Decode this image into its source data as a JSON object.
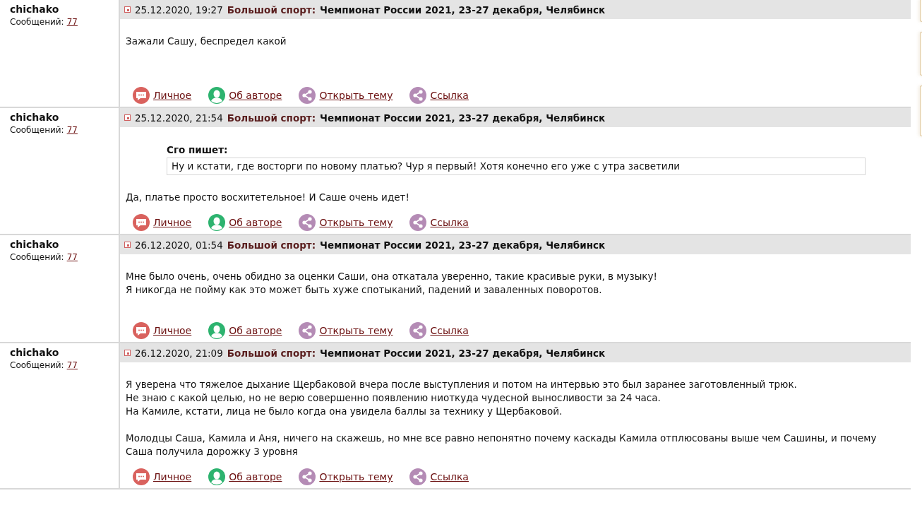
{
  "posts": [
    {
      "author": "chichako",
      "count_label": "Сообщений:",
      "count": "77",
      "date": "25.12.2020, 19:27",
      "forum": "Большой спорт:",
      "topic": "Чемпионат России 2021, 23-27 декабря, Челябинск",
      "paragraphs": [
        [
          "Зажали Сашу, беспредел какой"
        ]
      ],
      "actions": [
        {
          "kind": "message",
          "label": "Личное"
        },
        {
          "kind": "profile",
          "label": "Об авторе"
        },
        {
          "kind": "share",
          "label": "Открыть тему"
        },
        {
          "kind": "share",
          "label": "Ссылка"
        }
      ]
    },
    {
      "author": "chichako",
      "count_label": "Сообщений:",
      "count": "77",
      "date": "25.12.2020, 21:54",
      "forum": "Большой спорт:",
      "topic": "Чемпионат России 2021, 23-27 декабря, Челябинск",
      "quote": {
        "author": "Сго пишет:",
        "text": "Ну и кстати, где восторги по новому платью? Чур я первый! Хотя конечно его уже с утра засветили"
      },
      "paragraphs": [
        [
          "Да, платье просто восхитетельное! И Саше очень идет!"
        ]
      ],
      "actions": [
        {
          "kind": "message",
          "label": "Личное"
        },
        {
          "kind": "profile",
          "label": "Об авторе"
        },
        {
          "kind": "share",
          "label": "Открыть тему"
        },
        {
          "kind": "share",
          "label": "Ссылка"
        }
      ]
    },
    {
      "author": "chichako",
      "count_label": "Сообщений:",
      "count": "77",
      "date": "26.12.2020, 01:54",
      "forum": "Большой спорт:",
      "topic": "Чемпионат России 2021, 23-27 декабря, Челябинск",
      "paragraphs": [
        [
          "Мне было очень, очень обидно за оценки Саши, она откатала уверенно, такие красивые руки, в музыку!",
          "Я никогда не пойму как это может быть хуже спотыканий, падений и заваленных поворотов."
        ]
      ],
      "actions": [
        {
          "kind": "message",
          "label": "Личное"
        },
        {
          "kind": "profile",
          "label": "Об авторе"
        },
        {
          "kind": "share",
          "label": "Открыть тему"
        },
        {
          "kind": "share",
          "label": "Ссылка"
        }
      ]
    },
    {
      "author": "chichako",
      "count_label": "Сообщений:",
      "count": "77",
      "date": "26.12.2020, 21:09",
      "forum": "Большой спорт:",
      "topic": "Чемпионат России 2021, 23-27 декабря, Челябинск",
      "paragraphs": [
        [
          "Я уверена что тяжелое дыхание Щербаковой вчера после выступления и потом на интервью это был заранее заготовленный трюк.",
          "Не знаю с какой целью, но не верю совершенно появлению ниоткуда чудесной выносливости за 24 часа.",
          "На Камиле, кстати, лица не было когда она увидела баллы за технику у Щербаковой."
        ],
        [
          "Молодцы Саша, Камила и Аня, ничего на скажешь, но мне все равно непонятно почему каскады Камила отплюсованы выше чем Сашины, и почему Саша получила дорожку 3 уровня"
        ]
      ],
      "actions": [
        {
          "kind": "message",
          "label": "Личное"
        },
        {
          "kind": "profile",
          "label": "Об авторе"
        },
        {
          "kind": "share",
          "label": "Открыть тему"
        },
        {
          "kind": "share",
          "label": "Ссылка"
        }
      ]
    }
  ]
}
